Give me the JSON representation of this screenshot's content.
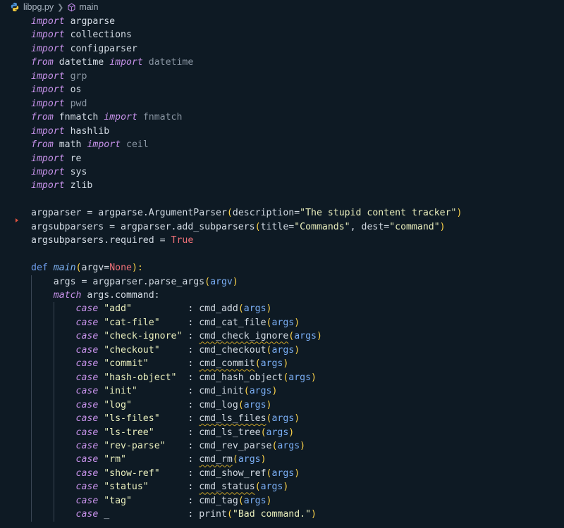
{
  "breadcrumb": {
    "file": "libpg.py",
    "symbol": "main"
  },
  "code": {
    "imports": [
      {
        "line": "import argparse"
      },
      {
        "line": "import collections"
      },
      {
        "line": "import configparser"
      },
      {
        "line": "from datetime import datetime"
      },
      {
        "line": "import grp"
      },
      {
        "line": "import os"
      },
      {
        "line": "import pwd"
      },
      {
        "line": "from fnmatch import fnmatch"
      },
      {
        "line": "import hashlib"
      },
      {
        "line": "from math import ceil"
      },
      {
        "line": "import re"
      },
      {
        "line": "import sys"
      },
      {
        "line": "import zlib"
      }
    ],
    "parser": {
      "line1_var": "argparser",
      "line1_call": "argparse.ArgumentParser",
      "line1_kw": "description=",
      "line1_str": "\"The stupid content tracker\"",
      "line2_var": "argsubparsers",
      "line2_call": "argparser.add_subparsers",
      "line2_kw1": "title=",
      "line2_str1": "\"Commands\"",
      "line2_kw2": "dest=",
      "line2_str2": "\"command\"",
      "line3_var": "argsubparsers.required",
      "line3_val": "True"
    },
    "main_def": {
      "kw": "def",
      "name": "main",
      "param": "argv=",
      "default": "None",
      "args_line": "args = argparser.parse_args",
      "args_arg": "argv",
      "match_kw": "match",
      "match_expr": "args.command:"
    },
    "cases": [
      {
        "label": "\"add\"",
        "func": "cmd_add",
        "squiggle": false
      },
      {
        "label": "\"cat-file\"",
        "func": "cmd_cat_file",
        "squiggle": false
      },
      {
        "label": "\"check-ignore\"",
        "func": "cmd_check_ignore",
        "squiggle": true
      },
      {
        "label": "\"checkout\"",
        "func": "cmd_checkout",
        "squiggle": false
      },
      {
        "label": "\"commit\"",
        "func": "cmd_commit",
        "squiggle": true
      },
      {
        "label": "\"hash-object\"",
        "func": "cmd_hash_object",
        "squiggle": false
      },
      {
        "label": "\"init\"",
        "func": "cmd_init",
        "squiggle": false
      },
      {
        "label": "\"log\"",
        "func": "cmd_log",
        "squiggle": false
      },
      {
        "label": "\"ls-files\"",
        "func": "cmd_ls_files",
        "squiggle": true
      },
      {
        "label": "\"ls-tree\"",
        "func": "cmd_ls_tree",
        "squiggle": false
      },
      {
        "label": "\"rev-parse\"",
        "func": "cmd_rev_parse",
        "squiggle": false
      },
      {
        "label": "\"rm\"",
        "func": "cmd_rm",
        "squiggle": true
      },
      {
        "label": "\"show-ref\"",
        "func": "cmd_show_ref",
        "squiggle": false
      },
      {
        "label": "\"status\"",
        "func": "cmd_status",
        "squiggle": true
      },
      {
        "label": "\"tag\"",
        "func": "cmd_tag",
        "squiggle": false
      }
    ],
    "case_kw": "case",
    "case_arg": "args",
    "default_case": {
      "label": "_",
      "call": "print",
      "str": "\"Bad command.\""
    }
  },
  "icons": [
    "python-file-icon",
    "chevron-right-icon",
    "symbol-method-icon",
    "breakpoint-marker-icon"
  ]
}
